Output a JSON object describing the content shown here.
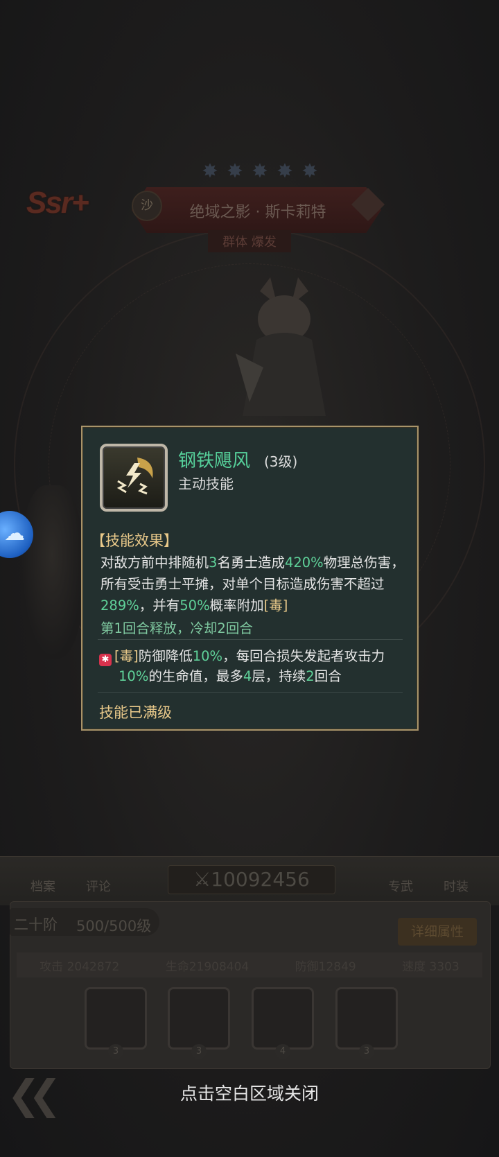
{
  "hero": {
    "rarity": "Ssr+",
    "faction": "沙",
    "name": "绝域之影 · 斯卡莉特",
    "tags": "群体 爆发",
    "stars": 5
  },
  "skill_popup": {
    "name": "钢铁飓风",
    "level": "(3级)",
    "type": "主动技能",
    "section_title": "【技能效果】",
    "desc": {
      "p1": "对敌方前中排随机",
      "n1": "3",
      "p2": "名勇士造成",
      "n2": "420%",
      "p3": "物理总伤害，所有受击勇士平摊，对单个目标造成伤害不超过",
      "n3": "289%",
      "p4": "，并有",
      "n4": "50%",
      "p5": "概率附加",
      "tag": "[毒]"
    },
    "cooldown": "第1回合释放，冷却2回合",
    "poison": {
      "icon": "poison-icon",
      "tag": "[毒]",
      "p1": "防御降低",
      "n1": "10%",
      "p2": "，每回合损失发起者攻击力",
      "n2": "10%",
      "p3": "的生命值，最多",
      "n3": "4",
      "p4": "层，持续",
      "n4": "2",
      "p5": "回合"
    },
    "maxed": "技能已满级"
  },
  "bottom": {
    "tab_archive": "档案",
    "tab_comment": "评论",
    "tab_weapon": "专武",
    "tab_costume": "时装",
    "power": "10092456",
    "rank": "二十阶",
    "level": "500/500级",
    "detail_button": "详细属性",
    "stats": {
      "attack_label": "攻击",
      "attack": "2042872",
      "hp_label": "生命",
      "hp": "21908404",
      "def_label": "防御",
      "def": "12849",
      "speed_label": "速度",
      "speed": "3303"
    },
    "skill_levels": [
      "3",
      "3",
      "4",
      "3"
    ]
  },
  "close_hint": "点击空白区域关闭",
  "colors": {
    "highlight_green": "#5fd199",
    "gold": "#e9c98a",
    "panel_bg": "#23302f",
    "panel_border": "#a8946a"
  }
}
